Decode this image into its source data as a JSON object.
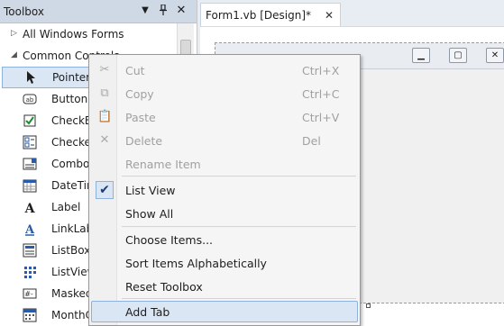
{
  "toolbox": {
    "title": "Toolbox",
    "groups": [
      {
        "label": "All Windows Forms",
        "expanded": false
      },
      {
        "label": "Common Controls",
        "expanded": true
      }
    ],
    "items": [
      {
        "label": "Pointer",
        "icon": "pointer-icon",
        "selected": true
      },
      {
        "label": "Button",
        "icon": "button-icon"
      },
      {
        "label": "CheckBox",
        "icon": "checkbox-icon"
      },
      {
        "label": "CheckedListBox",
        "icon": "checkedlistbox-icon"
      },
      {
        "label": "ComboBox",
        "icon": "combobox-icon"
      },
      {
        "label": "DateTimePicker",
        "icon": "datetimepicker-icon"
      },
      {
        "label": "Label",
        "icon": "label-icon"
      },
      {
        "label": "LinkLabel",
        "icon": "linklabel-icon"
      },
      {
        "label": "ListBox",
        "icon": "listbox-icon"
      },
      {
        "label": "ListView",
        "icon": "listview-icon"
      },
      {
        "label": "MaskedTextBox",
        "icon": "maskedtextbox-icon"
      },
      {
        "label": "MonthCalendar",
        "icon": "monthcalendar-icon"
      }
    ]
  },
  "designer": {
    "tab_label": "Form1.vb [Design]*"
  },
  "context_menu": {
    "items": [
      {
        "label": "Cut",
        "shortcut": "Ctrl+X",
        "enabled": false,
        "icon": "cut-icon"
      },
      {
        "label": "Copy",
        "shortcut": "Ctrl+C",
        "enabled": false,
        "icon": "copy-icon"
      },
      {
        "label": "Paste",
        "shortcut": "Ctrl+V",
        "enabled": false,
        "icon": "paste-icon"
      },
      {
        "label": "Delete",
        "shortcut": "Del",
        "enabled": false,
        "icon": "delete-icon"
      },
      {
        "label": "Rename Item",
        "shortcut": "",
        "enabled": false
      },
      {
        "label": "List View",
        "shortcut": "",
        "enabled": true,
        "checked": true
      },
      {
        "label": "Show All",
        "shortcut": "",
        "enabled": true
      },
      {
        "label": "Choose Items...",
        "shortcut": "",
        "enabled": true
      },
      {
        "label": "Sort Items Alphabetically",
        "shortcut": "",
        "enabled": true
      },
      {
        "label": "Reset Toolbox",
        "shortcut": "",
        "enabled": true
      },
      {
        "label": "Add Tab",
        "shortcut": "",
        "enabled": true,
        "highlighted": true
      }
    ]
  },
  "colors": {
    "title_bar": "#cfd9e6",
    "selection": "#dbe6f4",
    "selection_border": "#8fb1de",
    "disabled_text": "#a0a0a0"
  }
}
